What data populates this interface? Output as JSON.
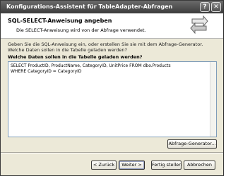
{
  "window": {
    "title": "Konfigurations-Assistent für TableAdapter-Abfragen",
    "help_label": "?",
    "close_label": "✕"
  },
  "header": {
    "title": "SQL-SELECT-Anweisung angeben",
    "subtitle": "Die SELECT-Anweisung wird von der Abfrage verwendet.",
    "icon": "wizard-arrows-icon"
  },
  "body": {
    "description": "Geben Sie die SQL-Anweisung ein, oder erstellen Sie sie mit dem Abfrage-Generator. Welche Daten sollen in die Tabelle geladen werden?",
    "question_label": "Welche Daten sollen in die Tabelle geladen werden?",
    "sql_lines": [
      "SELECT ProductID, ProductName, CategoryID, UnitPrice FROM dbo.Products",
      "WHERE CategoryID = CategoryID"
    ],
    "query_builder_label": "Abfrage-Generator..."
  },
  "footer": {
    "back_label": "< Zurück",
    "next_label": "Weiter >",
    "finish_label": "Fertig stellen",
    "cancel_label": "Abbrechen"
  }
}
